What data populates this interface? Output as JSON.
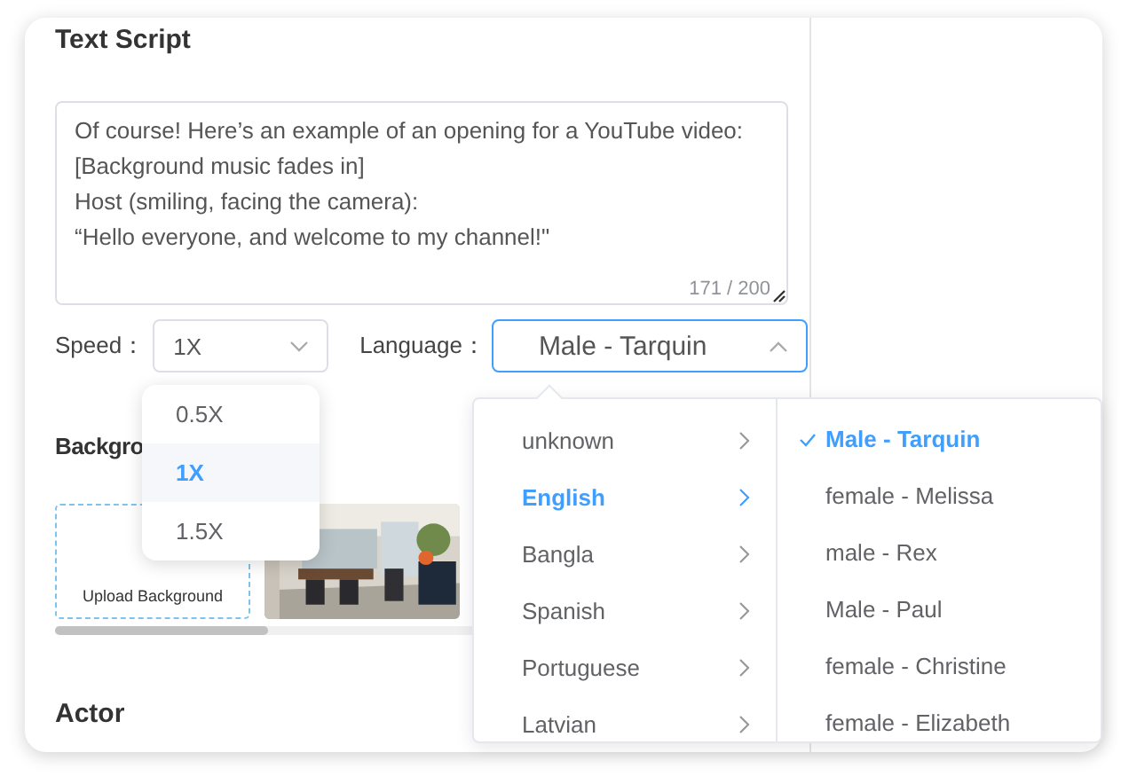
{
  "section_title": "Text Script",
  "script": {
    "value": "Of course! Here’s an example of an opening for a YouTube video:\n[Background music fades in]\nHost (smiling, facing the camera):\n“Hello everyone, and welcome to my channel!\"",
    "counter": "171 / 200"
  },
  "speed": {
    "label": "Speed：",
    "value": "1X",
    "open": true,
    "options": [
      {
        "label": "0.5X",
        "selected": false
      },
      {
        "label": "1X",
        "selected": true
      },
      {
        "label": "1.5X",
        "selected": false
      }
    ]
  },
  "language": {
    "label": "Language：",
    "value": "Male - Tarquin",
    "open": true,
    "languages": [
      {
        "label": "unknown",
        "selected": false
      },
      {
        "label": "English",
        "selected": true
      },
      {
        "label": "Bangla",
        "selected": false
      },
      {
        "label": "Spanish",
        "selected": false
      },
      {
        "label": "Portuguese",
        "selected": false
      },
      {
        "label": "Latvian",
        "selected": false
      }
    ],
    "voices": [
      {
        "label": "Male - Tarquin",
        "selected": true
      },
      {
        "label": "female - Melissa",
        "selected": false
      },
      {
        "label": "male - Rex",
        "selected": false
      },
      {
        "label": "Male - Paul",
        "selected": false
      },
      {
        "label": "female - Christine",
        "selected": false
      },
      {
        "label": "female - Elizabeth",
        "selected": false
      }
    ]
  },
  "background": {
    "title": "Backgro",
    "upload_label": "Upload Background"
  },
  "actor": {
    "title": "Actor"
  }
}
